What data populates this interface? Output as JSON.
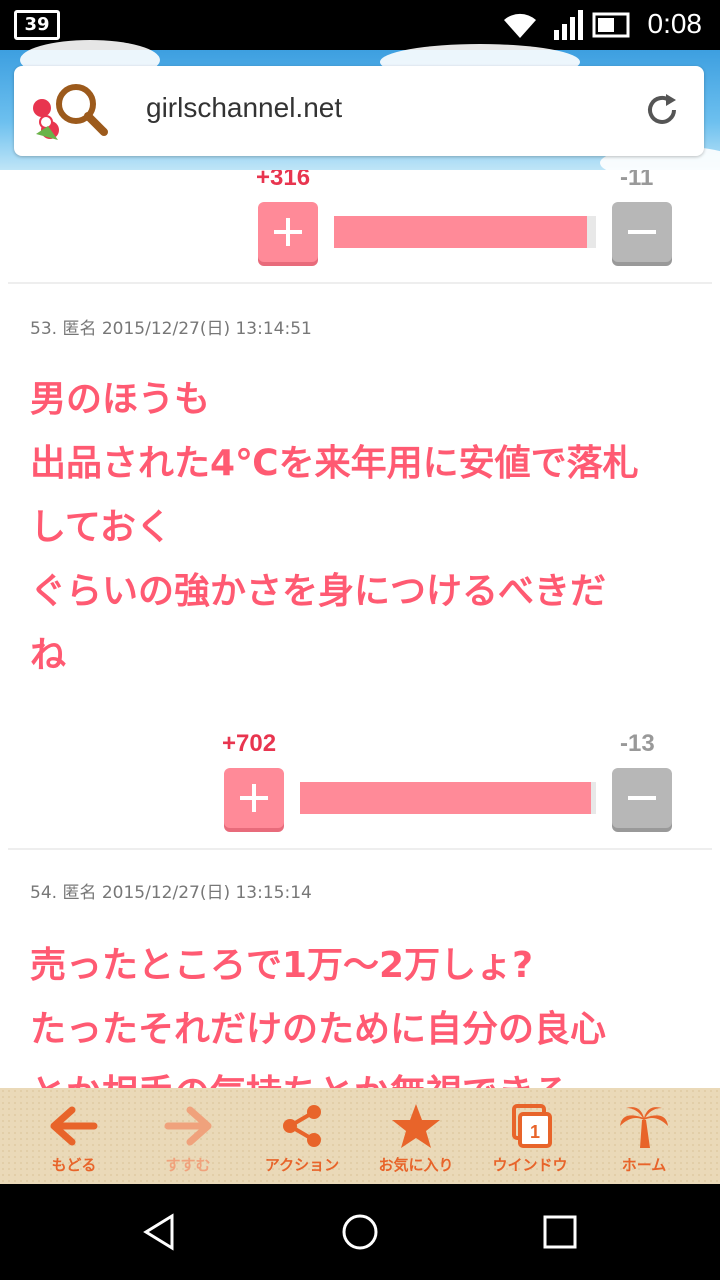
{
  "status_bar": {
    "time": "0:08",
    "left_icon": "39"
  },
  "browser": {
    "url": "girlschannel.net"
  },
  "colors": {
    "accent": "#ff5a72",
    "plus": "#ff8a98",
    "minus": "#b7b7b7",
    "toolbar_text": "#e8642a"
  },
  "posts": [
    {
      "plus": "+316",
      "minus": "-11",
      "ratio": 0.966
    },
    {
      "meta": "53. 匿名 2015/12/27(日) 13:14:51",
      "text": "男のほうも\n出品された4℃を来年用に安値で落札\nしておく\nぐらいの強かさを身につけるべきだ\nね",
      "plus": "+702",
      "minus": "-13",
      "ratio": 0.982
    },
    {
      "meta": "54. 匿名 2015/12/27(日) 13:15:14",
      "text": "売ったところで1万〜2万しょ?\nたったそれだけのために自分の良心\nとか相手の気持ちとか無視できる"
    }
  ],
  "toolbar": {
    "back": "もどる",
    "forward": "すすむ",
    "action": "アクション",
    "favorite": "お気に入り",
    "window": "ウインドウ",
    "window_count": "1",
    "home": "ホーム"
  }
}
